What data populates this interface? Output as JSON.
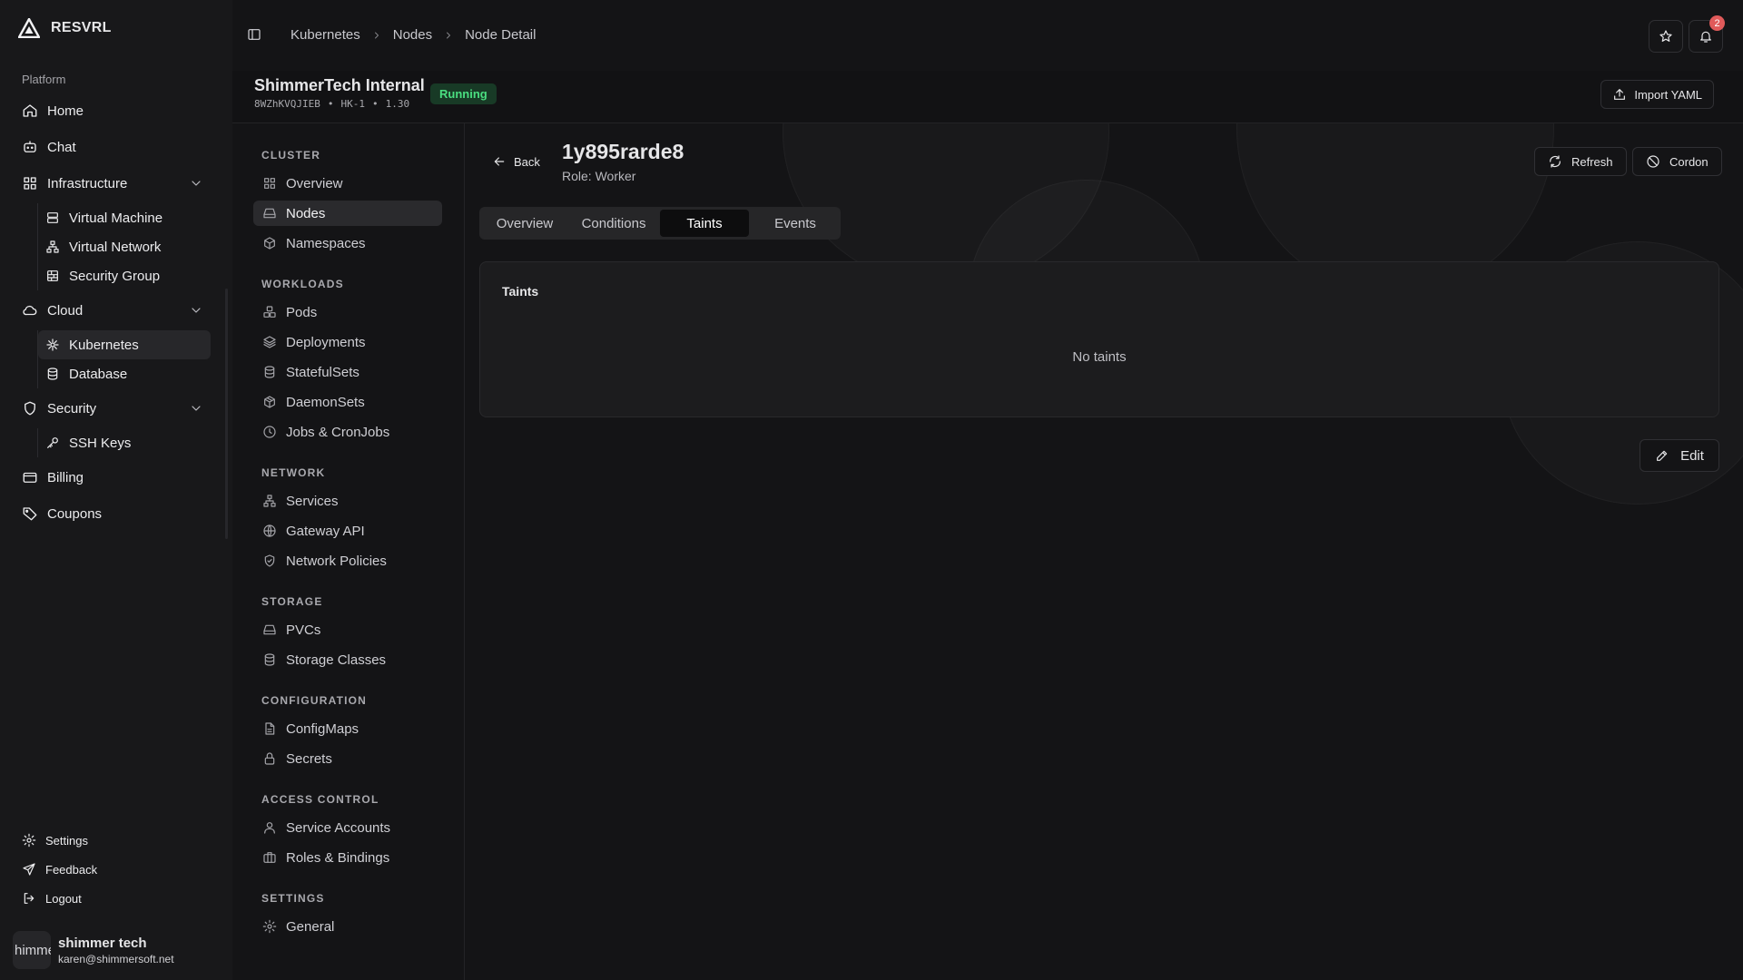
{
  "brand": {
    "name": "RESVRL"
  },
  "sidebar": {
    "group_label": "Platform",
    "items": [
      {
        "label": "Home",
        "icon": "home-icon"
      },
      {
        "label": "Chat",
        "icon": "chat-icon"
      },
      {
        "label": "Infrastructure",
        "icon": "grid-icon",
        "expanded": true,
        "children": [
          {
            "label": "Virtual Machine",
            "icon": "server-icon"
          },
          {
            "label": "Virtual Network",
            "icon": "network-icon"
          },
          {
            "label": "Security Group",
            "icon": "firewall-icon"
          }
        ]
      },
      {
        "label": "Cloud",
        "icon": "cloud-icon",
        "expanded": true,
        "children": [
          {
            "label": "Kubernetes",
            "icon": "kubernetes-icon",
            "active": true
          },
          {
            "label": "Database",
            "icon": "database-icon"
          }
        ]
      },
      {
        "label": "Security",
        "icon": "shield-icon",
        "expanded": true,
        "children": [
          {
            "label": "SSH Keys",
            "icon": "key-icon"
          }
        ]
      },
      {
        "label": "Billing",
        "icon": "credit-card-icon"
      },
      {
        "label": "Coupons",
        "icon": "tag-icon"
      }
    ],
    "footer": [
      {
        "label": "Settings",
        "icon": "gear-icon"
      },
      {
        "label": "Feedback",
        "icon": "send-icon"
      },
      {
        "label": "Logout",
        "icon": "logout-icon"
      }
    ],
    "user": {
      "avatar_text": "himme",
      "name": "shimmer tech",
      "email": "karen@shimmersoft.net"
    }
  },
  "topbar": {
    "breadcrumbs": [
      "Kubernetes",
      "Nodes",
      "Node Detail"
    ],
    "notification_count": "2"
  },
  "cluster": {
    "name": "ShimmerTech Internal",
    "id": "8WZhKVQJIEB",
    "region": "HK-1",
    "version": "1.30",
    "status": "Running",
    "import_label": "Import YAML"
  },
  "cluster_nav": {
    "sections": [
      {
        "label": "CLUSTER",
        "items": [
          {
            "label": "Overview",
            "icon": "overview-icon"
          },
          {
            "label": "Nodes",
            "icon": "hard-drive-icon",
            "active": true
          },
          {
            "label": "Namespaces",
            "icon": "box-icon"
          }
        ]
      },
      {
        "label": "WORKLOADS",
        "items": [
          {
            "label": "Pods",
            "icon": "pods-icon"
          },
          {
            "label": "Deployments",
            "icon": "layers-icon"
          },
          {
            "label": "StatefulSets",
            "icon": "database-icon"
          },
          {
            "label": "DaemonSets",
            "icon": "package-icon"
          },
          {
            "label": "Jobs & CronJobs",
            "icon": "clock-icon"
          }
        ]
      },
      {
        "label": "NETWORK",
        "items": [
          {
            "label": "Services",
            "icon": "network-icon"
          },
          {
            "label": "Gateway API",
            "icon": "globe-icon"
          },
          {
            "label": "Network Policies",
            "icon": "shield-check-icon"
          }
        ]
      },
      {
        "label": "STORAGE",
        "items": [
          {
            "label": "PVCs",
            "icon": "hard-drive-icon"
          },
          {
            "label": "Storage Classes",
            "icon": "database-icon"
          }
        ]
      },
      {
        "label": "CONFIGURATION",
        "items": [
          {
            "label": "ConfigMaps",
            "icon": "file-icon"
          },
          {
            "label": "Secrets",
            "icon": "lock-icon"
          }
        ]
      },
      {
        "label": "ACCESS CONTROL",
        "items": [
          {
            "label": "Service Accounts",
            "icon": "user-icon"
          },
          {
            "label": "Roles & Bindings",
            "icon": "briefcase-icon"
          }
        ]
      },
      {
        "label": "SETTINGS",
        "items": [
          {
            "label": "General",
            "icon": "gear-icon"
          }
        ]
      }
    ]
  },
  "node": {
    "back_label": "Back",
    "name": "1y895rarde8",
    "role": "Role: Worker",
    "refresh_label": "Refresh",
    "cordon_label": "Cordon",
    "tabs": [
      {
        "label": "Overview"
      },
      {
        "label": "Conditions"
      },
      {
        "label": "Taints",
        "active": true
      },
      {
        "label": "Events"
      }
    ],
    "taints": {
      "title": "Taints",
      "empty_text": "No taints"
    },
    "edit_label": "Edit"
  }
}
